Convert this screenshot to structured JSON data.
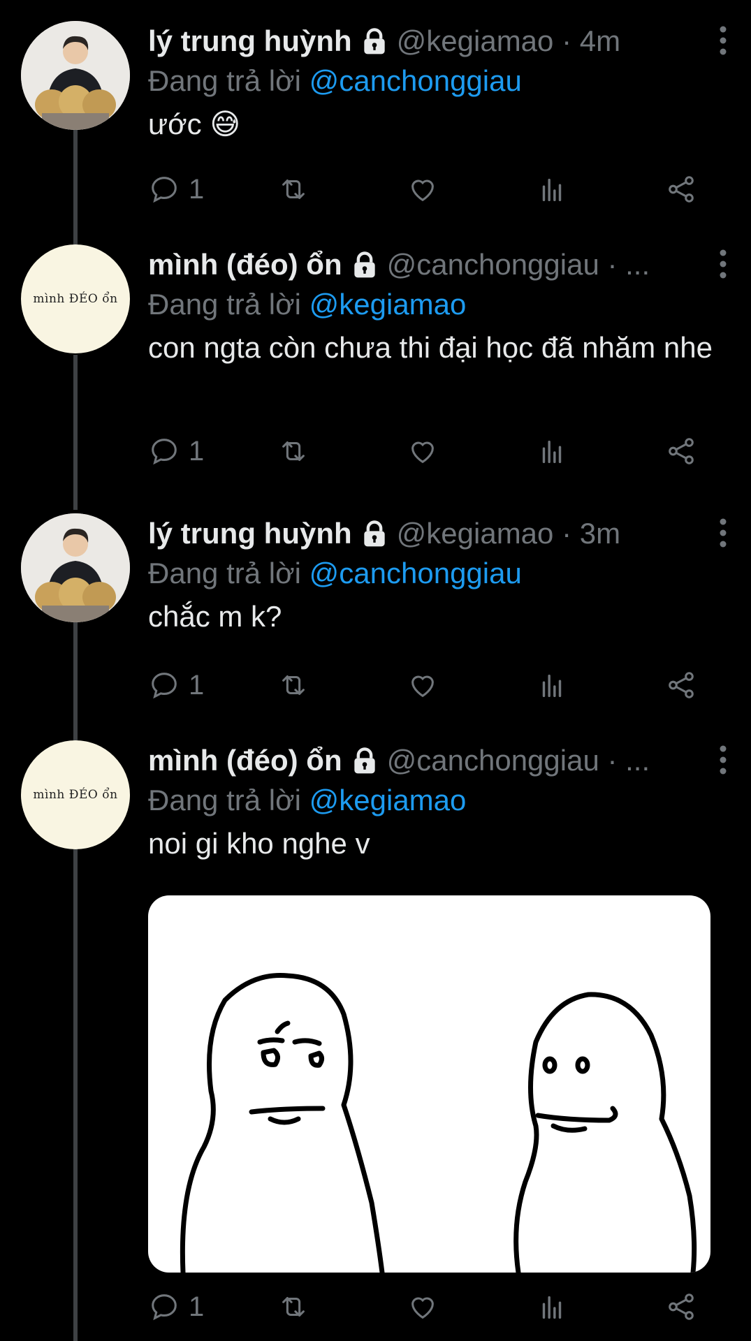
{
  "tweets": [
    {
      "name": "lý trung huỳnh",
      "handle": "@kegiamao · 4m",
      "reply_prefix": "Đang trả lời",
      "reply_to": "@canchonggiau",
      "text": "ước 😅",
      "reply_count": "1",
      "avatar": "photo"
    },
    {
      "name": "mình (đéo) ổn",
      "handle": "@canchonggiau · ...",
      "reply_prefix": "Đang trả lời",
      "reply_to": "@kegiamao",
      "text": "con ngta còn chưa thi đại học đã nhăm nhe",
      "reply_count": "1",
      "avatar": "text",
      "avatar_text": "mình ĐÉO ổn"
    },
    {
      "name": "lý trung huỳnh",
      "handle": "@kegiamao · 3m",
      "reply_prefix": "Đang trả lời",
      "reply_to": "@canchonggiau",
      "text": "chắc m k?",
      "reply_count": "1",
      "avatar": "photo"
    },
    {
      "name": "mình (đéo) ổn",
      "handle": "@canchonggiau · ...",
      "reply_prefix": "Đang trả lời",
      "reply_to": "@kegiamao",
      "text": "noi gi kho nghe v",
      "reply_count": "1",
      "avatar": "text",
      "avatar_text": "mình ĐÉO ổn",
      "media": "meme-two-characters"
    }
  ],
  "icons": {
    "reply": "reply-icon",
    "retweet": "retweet-icon",
    "like": "heart-icon",
    "views": "analytics-icon",
    "share": "share-icon",
    "lock": "lock-icon",
    "more": "more-vertical-icon"
  },
  "colors": {
    "background": "#000000",
    "text": "#e7e9ea",
    "muted": "#71767b",
    "link": "#1d9bf0",
    "thread_line": "#3e4144"
  }
}
